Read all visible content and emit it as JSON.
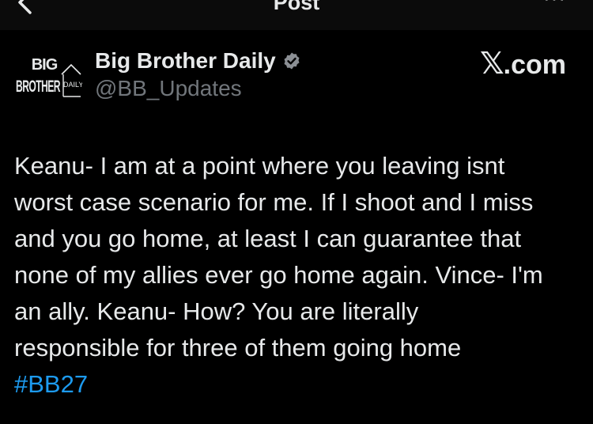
{
  "topbar": {
    "title": "Post",
    "back_icon": "chevron-left-icon",
    "more_label": "···"
  },
  "author": {
    "display_name": "Big Brother Daily",
    "handle": "@BB_Updates",
    "verified": true,
    "avatar_lines": [
      "BIG",
      "BROTHER",
      "DAILY"
    ]
  },
  "source": {
    "logo": "𝕏",
    "text": ".com"
  },
  "post": {
    "lines": [
      "Keanu- I am at a point where you leaving isnt",
      "worst case scenario for me. If I shoot and I miss",
      "and you go home, at least I can guarantee that",
      "none of my allies ever go home again. Vince- I'm",
      "an ally. Keanu- How? You are literally",
      "responsible for three of them going home"
    ],
    "hashtag": "#BB27"
  },
  "colors": {
    "background": "#000000",
    "text": "#e7e9ea",
    "secondary": "#71767b",
    "link": "#1d9bf0"
  }
}
